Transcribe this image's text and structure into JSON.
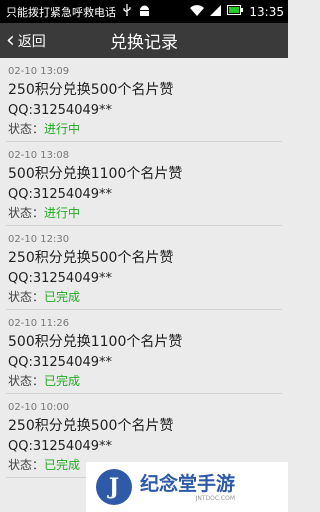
{
  "status_bar": {
    "carrier": "只能拨打紧急呼救电话",
    "time": "13:35"
  },
  "nav": {
    "back_label": "返回",
    "title": "兑换记录"
  },
  "status_prefix": "状态：",
  "records": [
    {
      "time": "02-10 13:09",
      "title": "250积分兑换500个名片赞",
      "qq": "QQ:31254049**",
      "status": "进行中"
    },
    {
      "time": "02-10 13:08",
      "title": "500积分兑换1100个名片赞",
      "qq": "QQ:31254049**",
      "status": "进行中"
    },
    {
      "time": "02-10 12:30",
      "title": "250积分兑换500个名片赞",
      "qq": "QQ:31254049**",
      "status": "已完成"
    },
    {
      "time": "02-10 11:26",
      "title": "500积分兑换1100个名片赞",
      "qq": "QQ:31254049**",
      "status": "已完成"
    },
    {
      "time": "02-10 10:00",
      "title": "250积分兑换500个名片赞",
      "qq": "QQ:31254049**",
      "status": "已完成"
    }
  ],
  "watermark": {
    "name": "纪念堂手游",
    "sub": "JNTDOC.COM",
    "logo_letter": "J"
  },
  "colors": {
    "status_green": "#22aa22",
    "nav_bg": "#3a3a3a",
    "battery_green": "#22cc22"
  }
}
